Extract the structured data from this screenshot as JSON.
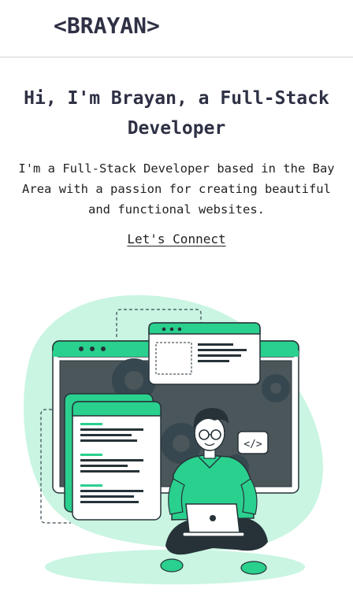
{
  "header": {
    "logo": "<BRAYAN>"
  },
  "hero": {
    "title": "Hi, I'm Brayan, a Full-Stack Developer",
    "description": "I'm a Full-Stack Developer based in the Bay Area with a passion for creating beautiful and functional websites.",
    "cta_label": "Let's Connect"
  },
  "illustration": {
    "name": "developer-laptop-illustration",
    "code_badge": "</>"
  },
  "colors": {
    "text": "#2e3044",
    "accent": "#2ad08e",
    "accent_light": "#c9f5e2",
    "dark": "#263238"
  }
}
